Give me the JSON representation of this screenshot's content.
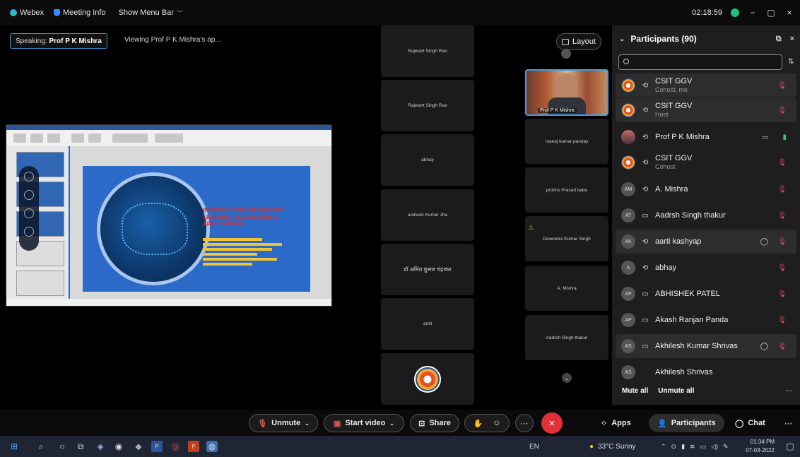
{
  "topbar": {
    "app_name": "Webex",
    "meeting_info": "Meeting Info",
    "show_menu_bar": "Show Menu Bar",
    "timer": "02:18:59",
    "minimize": "−",
    "restore": "▢",
    "close": "×"
  },
  "status": {
    "speaking_label": "Speaking:",
    "speaker": "Prof P K Mishra",
    "viewing": "Viewing Prof P K Mishra's ap..."
  },
  "slide": {
    "title": "INTRODUCTION ON MACHINE LEARNING ALGORITHMS & APPLICATIONS"
  },
  "video_grid": {
    "column1": [
      "Rajwant Singh Rao",
      "Rajwant Singh Rao",
      "abhay",
      "amitesh Kumar Jha",
      "डॉ अमित कुमार चंद्राकर",
      "amit"
    ],
    "self_view_name": "Prof P K Mishra",
    "column2": [
      "manoj kumar panday",
      "prohns Prasad babu",
      "Devendra Kumar Singh",
      "A. Mishra",
      "Aadrsh Singh thakur"
    ],
    "layout_label": "Layout"
  },
  "participants": {
    "header": "Participants (90)",
    "search_placeholder": "",
    "rows": [
      {
        "avatar": "",
        "name": "CSIT GGV",
        "role": "Cohost, me",
        "type": "⟲",
        "mic": "muted"
      },
      {
        "avatar": "",
        "name": "CSIT GGV",
        "role": "Host",
        "type": "⟲",
        "mic": "muted"
      },
      {
        "avatar": "",
        "name": "Prof P K Mishra",
        "role": "",
        "type": "⟲",
        "mic": "on"
      },
      {
        "avatar": "",
        "name": "CSIT GGV",
        "role": "Cohost",
        "type": "⟲",
        "mic": "muted"
      },
      {
        "avatar": "AM",
        "name": "A. Mishra",
        "role": "",
        "type": "⟲",
        "mic": "muted"
      },
      {
        "avatar": "AT",
        "name": "Aadrsh Singh thakur",
        "role": "",
        "type": "▭",
        "mic": "muted"
      },
      {
        "avatar": "AK",
        "name": "aarti kashyap",
        "role": "",
        "type": "⟲",
        "mic": "muted"
      },
      {
        "avatar": "A",
        "name": "abhay",
        "role": "",
        "type": "⟲",
        "mic": "muted"
      },
      {
        "avatar": "AP",
        "name": "ABHISHEK PATEL",
        "role": "",
        "type": "▭",
        "mic": "muted"
      },
      {
        "avatar": "AP",
        "name": "Akash Ranjan Panda",
        "role": "",
        "type": "▭",
        "mic": "muted"
      },
      {
        "avatar": "AS",
        "name": "Akhilesh Kumar Shrivas",
        "role": "",
        "type": "▭",
        "mic": "muted"
      },
      {
        "avatar": "AS",
        "name": "Akhilesh Shrivas",
        "role": "",
        "type": "",
        "mic": "none"
      }
    ],
    "mute_all": "Mute all",
    "unmute_all": "Unmute all"
  },
  "controls": {
    "unmute": "Unmute",
    "start_video": "Start video",
    "share": "Share",
    "apps": "Apps",
    "participants": "Participants",
    "chat": "Chat"
  },
  "taskbar": {
    "language": "EN",
    "weather": "33°C Sunny",
    "time": "01:34 PM",
    "date": "07-03-2022"
  },
  "colors": {
    "accent": "#2d8cff",
    "end_call": "#e0303a",
    "muted": "#e0535a",
    "unmuted": "#3fbf6a"
  }
}
